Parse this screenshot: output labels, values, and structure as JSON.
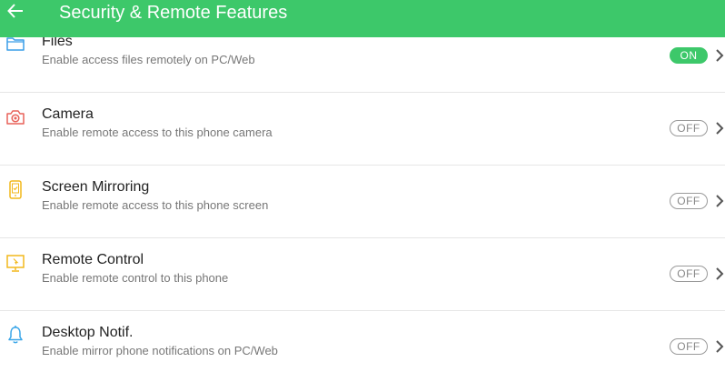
{
  "header": {
    "title": "Security & Remote Features",
    "back_icon": "arrow-left-icon",
    "bg_color": "#3dc86a"
  },
  "features": [
    {
      "id": "files",
      "icon": "folder-icon",
      "icon_color": "#3a9ee8",
      "title": "Files",
      "subtitle": "Enable access files remotely on PC/Web",
      "toggle": "ON",
      "state": "on"
    },
    {
      "id": "camera",
      "icon": "camera-icon",
      "icon_color": "#e8625a",
      "title": "Camera",
      "subtitle": "Enable remote access to this phone camera",
      "toggle": "OFF",
      "state": "off"
    },
    {
      "id": "screen-mirroring",
      "icon": "phone-screen-icon",
      "icon_color": "#f2b81c",
      "title": "Screen Mirroring",
      "subtitle": "Enable remote access to this phone screen",
      "toggle": "OFF",
      "state": "off"
    },
    {
      "id": "remote-control",
      "icon": "monitor-cursor-icon",
      "icon_color": "#f2b81c",
      "title": "Remote Control",
      "subtitle": "Enable remote control to this phone",
      "toggle": "OFF",
      "state": "off"
    },
    {
      "id": "desktop-notif",
      "icon": "bell-icon",
      "icon_color": "#3aa6e8",
      "title": "Desktop Notif.",
      "subtitle": "Enable mirror phone notifications on PC/Web",
      "toggle": "OFF",
      "state": "off"
    }
  ],
  "colors": {
    "accent": "#3dc86a",
    "toggle_off_border": "#9a9a9a",
    "divider": "#e6e6e6"
  }
}
